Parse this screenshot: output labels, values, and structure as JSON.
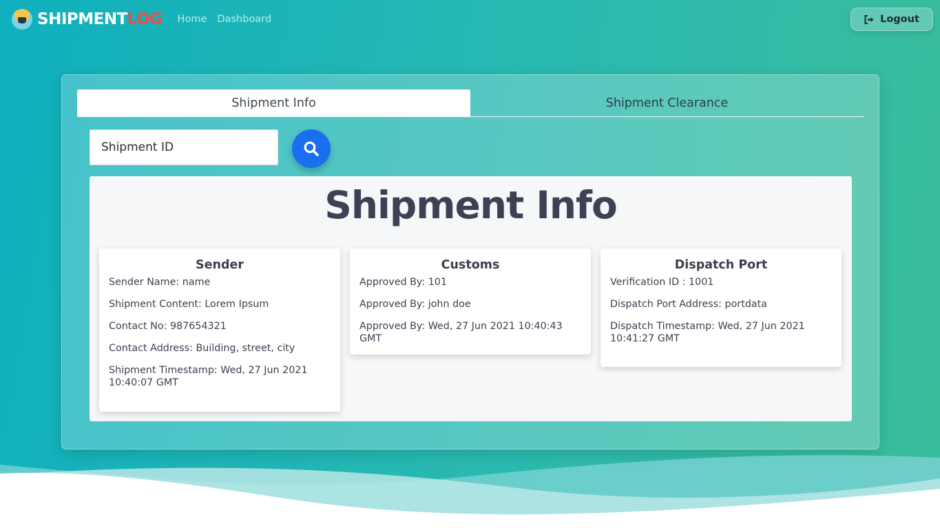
{
  "navbar": {
    "brand_part1": "SHIPMENT",
    "brand_part2": "LOG",
    "links": [
      "Home",
      "Dashboard"
    ],
    "logout_label": "Logout"
  },
  "tabs": [
    {
      "label": "Shipment Info",
      "active": true
    },
    {
      "label": "Shipment Clearance",
      "active": false
    }
  ],
  "search": {
    "placeholder": "Shipment ID",
    "value": ""
  },
  "info": {
    "title": "Shipment Info",
    "cards": [
      {
        "title": "Sender",
        "lines": [
          "Sender Name: name",
          "Shipment Content: Lorem Ipsum",
          "Contact No: 987654321",
          "Contact Address: Building, street, city",
          "Shipment Timestamp: Wed, 27 Jun 2021 10:40:07 GMT"
        ]
      },
      {
        "title": "Customs",
        "lines": [
          "Approved By: 101",
          "Approved By: john doe",
          "Approved By: Wed, 27 Jun 2021 10:40:43 GMT"
        ]
      },
      {
        "title": "Dispatch Port",
        "lines": [
          "Verification ID : 1001",
          "Dispatch Port Address: portdata",
          "Dispatch Timestamp: Wed, 27 Jun 2021 10:41:27 GMT"
        ]
      }
    ]
  },
  "colors": {
    "brand_accent": "#ef4d4d",
    "search_button": "#1a6ef0",
    "background_start": "#0fb0be",
    "background_end": "#3bbd9a"
  },
  "icons": {
    "logo": "ship-logo-icon",
    "logout": "sign-out-icon",
    "search": "magnifier-icon"
  }
}
